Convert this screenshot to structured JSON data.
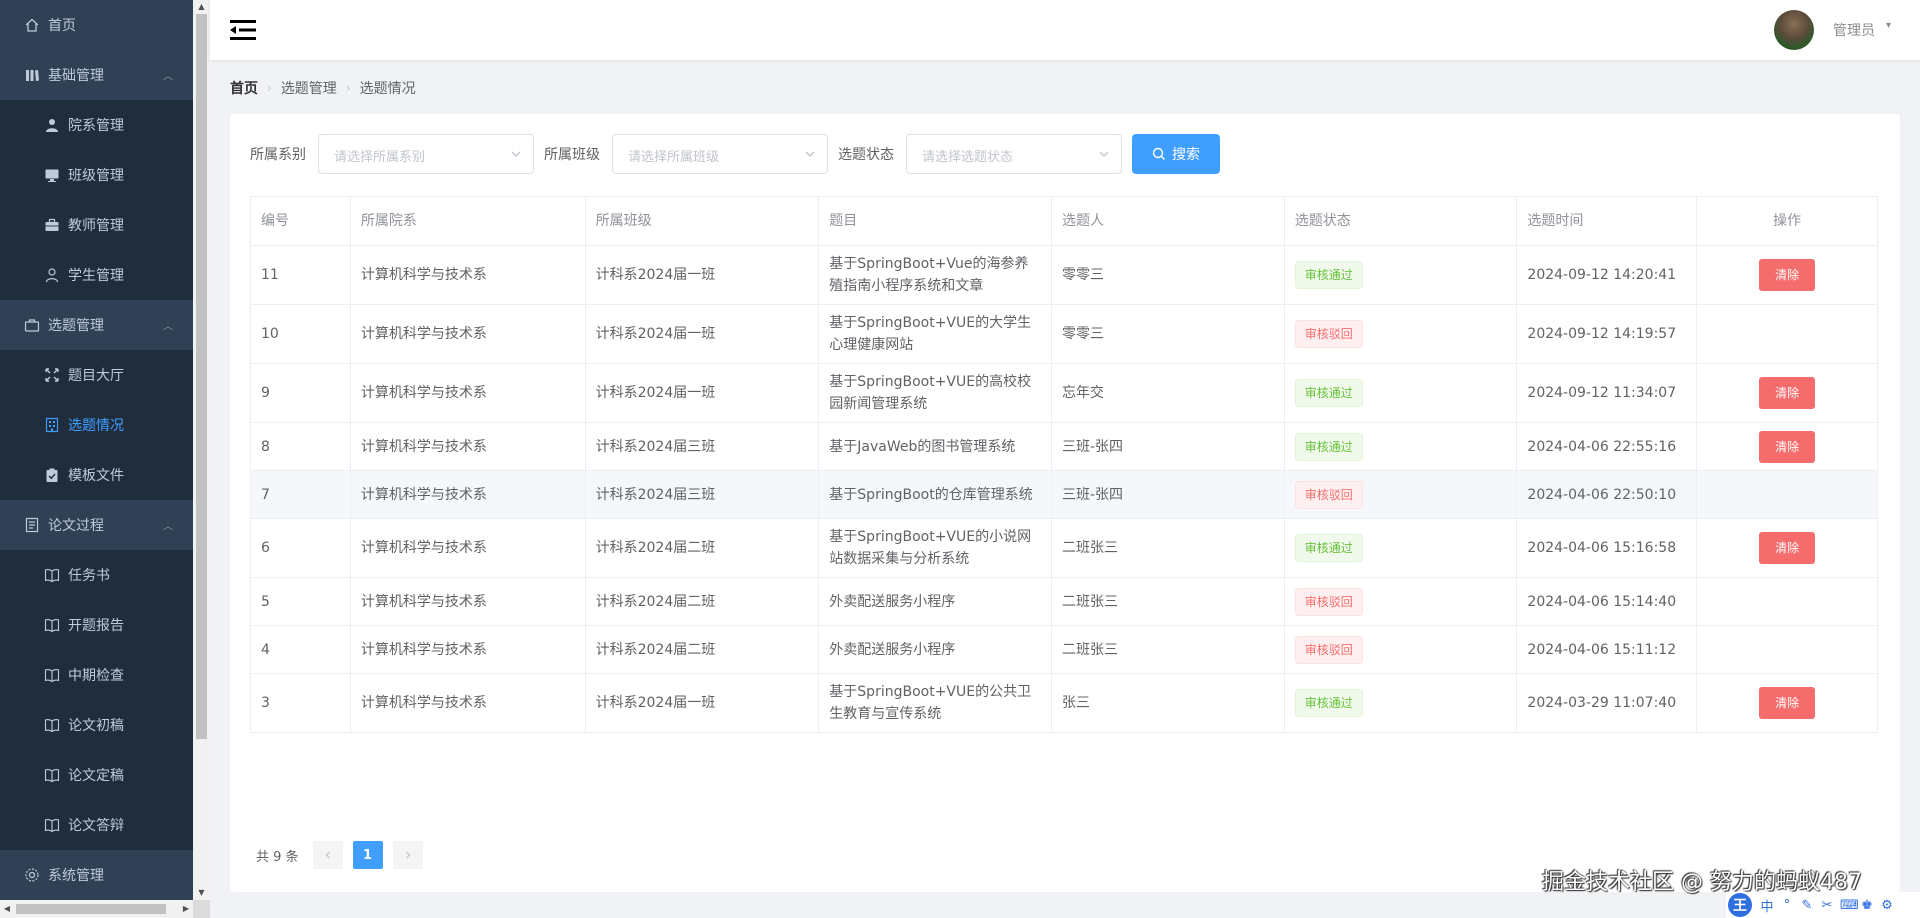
{
  "sidebar": {
    "items": [
      {
        "label": "首页",
        "icon": "home-icon",
        "level": "top"
      },
      {
        "label": "基础管理",
        "icon": "library-icon",
        "level": "top",
        "expanded": true
      },
      {
        "label": "院系管理",
        "icon": "user-icon",
        "level": "sub"
      },
      {
        "label": "班级管理",
        "icon": "monitor-icon",
        "level": "sub"
      },
      {
        "label": "教师管理",
        "icon": "briefcase-icon",
        "level": "sub"
      },
      {
        "label": "学生管理",
        "icon": "user-outline-icon",
        "level": "sub"
      },
      {
        "label": "选题管理",
        "icon": "suitcase-icon",
        "level": "top",
        "expanded": true
      },
      {
        "label": "题目大厅",
        "icon": "fullscreen-icon",
        "level": "sub"
      },
      {
        "label": "选题情况",
        "icon": "office-building-icon",
        "level": "sub",
        "active": true
      },
      {
        "label": "模板文件",
        "icon": "clipboard-check-icon",
        "level": "sub"
      },
      {
        "label": "论文过程",
        "icon": "document-icon",
        "level": "top",
        "expanded": true
      },
      {
        "label": "任务书",
        "icon": "book-icon",
        "level": "sub"
      },
      {
        "label": "开题报告",
        "icon": "book-icon",
        "level": "sub"
      },
      {
        "label": "中期检查",
        "icon": "book-icon",
        "level": "sub"
      },
      {
        "label": "论文初稿",
        "icon": "book-icon",
        "level": "sub"
      },
      {
        "label": "论文定稿",
        "icon": "book-icon",
        "level": "sub"
      },
      {
        "label": "论文答辩",
        "icon": "book-icon",
        "level": "sub"
      },
      {
        "label": "系统管理",
        "icon": "settings-icon",
        "level": "top"
      }
    ],
    "colors": {
      "bg": "#304156",
      "sub_bg": "#1f2d3d",
      "text": "#bfcbd9",
      "active": "#409eff"
    }
  },
  "navbar": {
    "username": "管理员"
  },
  "breadcrumb": [
    "首页",
    "选题管理",
    "选题情况"
  ],
  "filters": {
    "dept_label": "所属系别",
    "dept_placeholder": "请选择所属系别",
    "class_label": "所属班级",
    "class_placeholder": "请选择所属班级",
    "status_label": "选题状态",
    "status_placeholder": "请选择选题状态",
    "search_label": "搜索"
  },
  "table": {
    "headers": {
      "id": "编号",
      "dept": "所属院系",
      "cls": "所属班级",
      "topic": "题目",
      "person": "选题人",
      "status": "选题状态",
      "time": "选题时间",
      "op": "操作"
    },
    "rows": [
      {
        "id": "11",
        "dept": "计算机科学与技术系",
        "cls": "计科系2024届一班",
        "topic": "基于SpringBoot+Vue的海参养殖指南小程序系统和文章",
        "person": "零零三",
        "status": "审核通过",
        "ok": true,
        "time": "2024-09-12 14:20:41",
        "action": "清除"
      },
      {
        "id": "10",
        "dept": "计算机科学与技术系",
        "cls": "计科系2024届一班",
        "topic": "基于SpringBoot+VUE的大学生心理健康网站",
        "person": "零零三",
        "status": "审核驳回",
        "ok": false,
        "time": "2024-09-12 14:19:57",
        "action": ""
      },
      {
        "id": "9",
        "dept": "计算机科学与技术系",
        "cls": "计科系2024届一班",
        "topic": "基于SpringBoot+VUE的高校校园新闻管理系统",
        "person": "忘年交",
        "status": "审核通过",
        "ok": true,
        "time": "2024-09-12 11:34:07",
        "action": "清除"
      },
      {
        "id": "8",
        "dept": "计算机科学与技术系",
        "cls": "计科系2024届三班",
        "topic": "基于JavaWeb的图书管理系统",
        "person": "三班-张四",
        "status": "审核通过",
        "ok": true,
        "time": "2024-04-06 22:55:16",
        "action": "清除"
      },
      {
        "id": "7",
        "dept": "计算机科学与技术系",
        "cls": "计科系2024届三班",
        "topic": "基于SpringBoot的仓库管理系统",
        "person": "三班-张四",
        "status": "审核驳回",
        "ok": false,
        "time": "2024-04-06 22:50:10",
        "action": ""
      },
      {
        "id": "6",
        "dept": "计算机科学与技术系",
        "cls": "计科系2024届二班",
        "topic": "基于SpringBoot+VUE的小说网站数据采集与分析系统",
        "person": "二班张三",
        "status": "审核通过",
        "ok": true,
        "time": "2024-04-06 15:16:58",
        "action": "清除"
      },
      {
        "id": "5",
        "dept": "计算机科学与技术系",
        "cls": "计科系2024届二班",
        "topic": "外卖配送服务小程序",
        "person": "二班张三",
        "status": "审核驳回",
        "ok": false,
        "time": "2024-04-06 15:14:40",
        "action": ""
      },
      {
        "id": "4",
        "dept": "计算机科学与技术系",
        "cls": "计科系2024届二班",
        "topic": "外卖配送服务小程序",
        "person": "二班张三",
        "status": "审核驳回",
        "ok": false,
        "time": "2024-04-06 15:11:12",
        "action": ""
      },
      {
        "id": "3",
        "dept": "计算机科学与技术系",
        "cls": "计科系2024届一班",
        "topic": "基于SpringBoot+VUE的公共卫生教育与宣传系统",
        "person": "张三",
        "status": "审核通过",
        "ok": true,
        "time": "2024-03-29 11:07:40",
        "action": "清除"
      }
    ],
    "hover_row": "7"
  },
  "pagination": {
    "total_text": "共 9 条",
    "current_page": "1"
  },
  "watermark": "掘金技术社区 @ 努力的蚂蚁487",
  "ime": {
    "logo": "王",
    "mode": "中"
  }
}
